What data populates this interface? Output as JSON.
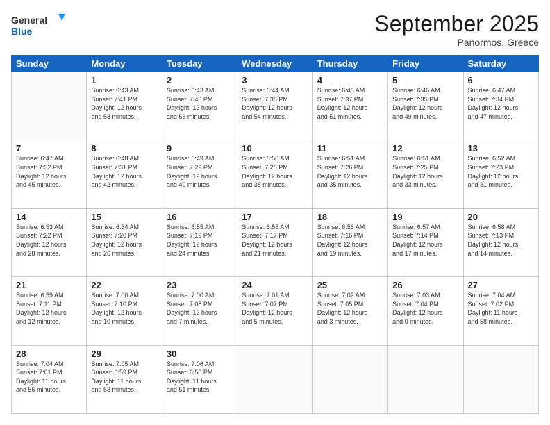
{
  "header": {
    "logo_line1": "General",
    "logo_line2": "Blue",
    "month": "September 2025",
    "location": "Panormos, Greece"
  },
  "weekdays": [
    "Sunday",
    "Monday",
    "Tuesday",
    "Wednesday",
    "Thursday",
    "Friday",
    "Saturday"
  ],
  "weeks": [
    [
      {
        "day": "",
        "info": ""
      },
      {
        "day": "1",
        "info": "Sunrise: 6:43 AM\nSunset: 7:41 PM\nDaylight: 12 hours\nand 58 minutes."
      },
      {
        "day": "2",
        "info": "Sunrise: 6:43 AM\nSunset: 7:40 PM\nDaylight: 12 hours\nand 56 minutes."
      },
      {
        "day": "3",
        "info": "Sunrise: 6:44 AM\nSunset: 7:38 PM\nDaylight: 12 hours\nand 54 minutes."
      },
      {
        "day": "4",
        "info": "Sunrise: 6:45 AM\nSunset: 7:37 PM\nDaylight: 12 hours\nand 51 minutes."
      },
      {
        "day": "5",
        "info": "Sunrise: 6:46 AM\nSunset: 7:35 PM\nDaylight: 12 hours\nand 49 minutes."
      },
      {
        "day": "6",
        "info": "Sunrise: 6:47 AM\nSunset: 7:34 PM\nDaylight: 12 hours\nand 47 minutes."
      }
    ],
    [
      {
        "day": "7",
        "info": "Sunrise: 6:47 AM\nSunset: 7:32 PM\nDaylight: 12 hours\nand 45 minutes."
      },
      {
        "day": "8",
        "info": "Sunrise: 6:48 AM\nSunset: 7:31 PM\nDaylight: 12 hours\nand 42 minutes."
      },
      {
        "day": "9",
        "info": "Sunrise: 6:49 AM\nSunset: 7:29 PM\nDaylight: 12 hours\nand 40 minutes."
      },
      {
        "day": "10",
        "info": "Sunrise: 6:50 AM\nSunset: 7:28 PM\nDaylight: 12 hours\nand 38 minutes."
      },
      {
        "day": "11",
        "info": "Sunrise: 6:51 AM\nSunset: 7:26 PM\nDaylight: 12 hours\nand 35 minutes."
      },
      {
        "day": "12",
        "info": "Sunrise: 6:51 AM\nSunset: 7:25 PM\nDaylight: 12 hours\nand 33 minutes."
      },
      {
        "day": "13",
        "info": "Sunrise: 6:52 AM\nSunset: 7:23 PM\nDaylight: 12 hours\nand 31 minutes."
      }
    ],
    [
      {
        "day": "14",
        "info": "Sunrise: 6:53 AM\nSunset: 7:22 PM\nDaylight: 12 hours\nand 28 minutes."
      },
      {
        "day": "15",
        "info": "Sunrise: 6:54 AM\nSunset: 7:20 PM\nDaylight: 12 hours\nand 26 minutes."
      },
      {
        "day": "16",
        "info": "Sunrise: 6:55 AM\nSunset: 7:19 PM\nDaylight: 12 hours\nand 24 minutes."
      },
      {
        "day": "17",
        "info": "Sunrise: 6:55 AM\nSunset: 7:17 PM\nDaylight: 12 hours\nand 21 minutes."
      },
      {
        "day": "18",
        "info": "Sunrise: 6:56 AM\nSunset: 7:16 PM\nDaylight: 12 hours\nand 19 minutes."
      },
      {
        "day": "19",
        "info": "Sunrise: 6:57 AM\nSunset: 7:14 PM\nDaylight: 12 hours\nand 17 minutes."
      },
      {
        "day": "20",
        "info": "Sunrise: 6:58 AM\nSunset: 7:13 PM\nDaylight: 12 hours\nand 14 minutes."
      }
    ],
    [
      {
        "day": "21",
        "info": "Sunrise: 6:59 AM\nSunset: 7:11 PM\nDaylight: 12 hours\nand 12 minutes."
      },
      {
        "day": "22",
        "info": "Sunrise: 7:00 AM\nSunset: 7:10 PM\nDaylight: 12 hours\nand 10 minutes."
      },
      {
        "day": "23",
        "info": "Sunrise: 7:00 AM\nSunset: 7:08 PM\nDaylight: 12 hours\nand 7 minutes."
      },
      {
        "day": "24",
        "info": "Sunrise: 7:01 AM\nSunset: 7:07 PM\nDaylight: 12 hours\nand 5 minutes."
      },
      {
        "day": "25",
        "info": "Sunrise: 7:02 AM\nSunset: 7:05 PM\nDaylight: 12 hours\nand 3 minutes."
      },
      {
        "day": "26",
        "info": "Sunrise: 7:03 AM\nSunset: 7:04 PM\nDaylight: 12 hours\nand 0 minutes."
      },
      {
        "day": "27",
        "info": "Sunrise: 7:04 AM\nSunset: 7:02 PM\nDaylight: 11 hours\nand 58 minutes."
      }
    ],
    [
      {
        "day": "28",
        "info": "Sunrise: 7:04 AM\nSunset: 7:01 PM\nDaylight: 11 hours\nand 56 minutes."
      },
      {
        "day": "29",
        "info": "Sunrise: 7:05 AM\nSunset: 6:59 PM\nDaylight: 11 hours\nand 53 minutes."
      },
      {
        "day": "30",
        "info": "Sunrise: 7:06 AM\nSunset: 6:58 PM\nDaylight: 11 hours\nand 51 minutes."
      },
      {
        "day": "",
        "info": ""
      },
      {
        "day": "",
        "info": ""
      },
      {
        "day": "",
        "info": ""
      },
      {
        "day": "",
        "info": ""
      }
    ]
  ]
}
